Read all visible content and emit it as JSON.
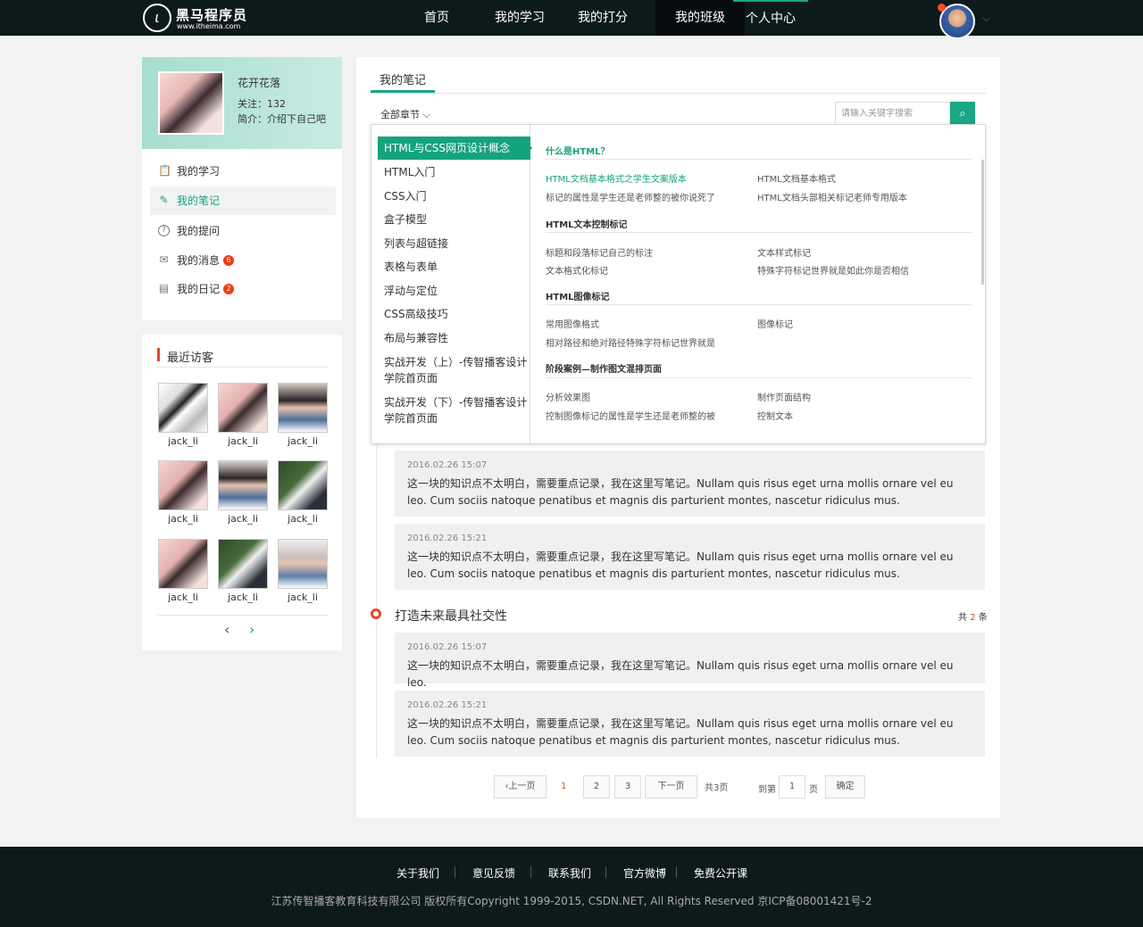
{
  "header": {
    "logo_title": "黑马程序员",
    "logo_sub": "www.itheima.com",
    "logo_mark": "ι",
    "nav": [
      "首页",
      "我的学习",
      "我的打分",
      "我的班级",
      "个人中心"
    ],
    "chevron": "⌵"
  },
  "profile": {
    "name": "花开花落",
    "follows": "关注：132",
    "intro": "简介：介绍下自己吧"
  },
  "menu": [
    {
      "label": "我的学习",
      "icon": "📋"
    },
    {
      "label": "我的笔记",
      "icon": "✎"
    },
    {
      "label": "我的提问",
      "icon": "?"
    },
    {
      "label": "我的消息",
      "icon": "✉",
      "badge": "6"
    },
    {
      "label": "我的日记",
      "icon": "▤",
      "badge": "2"
    }
  ],
  "visitors": {
    "title": "最近访客",
    "names": [
      "jack_li",
      "jack_li",
      "jack_li",
      "jack_li",
      "jack_li",
      "jack_li",
      "jack_li",
      "jack_li",
      "jack_li"
    ],
    "prev": "‹",
    "next": "›"
  },
  "main": {
    "title": "我的笔记",
    "chapter_select": "全部章节 ⌵",
    "search_placeholder": "请输入关键字搜索",
    "search_icon": "⌕"
  },
  "chapters": [
    "HTML与CSS网页设计概念",
    "HTML入门",
    "CSS入门",
    "盒子模型",
    "列表与超链接",
    "表格与表单",
    "浮动与定位",
    "CSS高级技巧",
    "布局与兼容性",
    "实战开发（上）-传智播客设计",
    "学院首页面",
    "实战开发（下）-传智播客设计",
    "学院首页面"
  ],
  "sections": [
    {
      "title": "什么是HTML？",
      "links": [
        "HTML文档基本格式之学生文案版本",
        "HTML文档基本格式",
        "标记的属性是学生还是老师整的被你说死了",
        "HTML文档头部相关标记老师专用版本"
      ]
    },
    {
      "title": "HTML文本控制标记",
      "links": [
        "标题和段落标记自己的标注",
        "文本样式标记",
        "文本格式化标记",
        "特殊字符标记世界就是如此你是否相信"
      ]
    },
    {
      "title": "HTML图像标记",
      "links": [
        "常用图像格式",
        "图像标记",
        "相对路径和绝对路径特殊字符标记世界就是"
      ]
    },
    {
      "title": "阶段案例—制作图文混排页面",
      "links": [
        "分析效果图",
        "制作页面结构",
        "控制图像标记的属性是学生还是老师整的被",
        "控制文本"
      ]
    }
  ],
  "notes_a": [
    {
      "time": "2016.02.26 15:07",
      "body": "这一块的知识点不太明白，需要重点记录，我在这里写笔记。Nullam quis risus eget urna mollis ornare vel eu leo. Cum sociis natoque penatibus et magnis dis parturient montes, nascetur ridiculus mus."
    },
    {
      "time": "2016.02.26 15:21",
      "body": "这一块的知识点不太明白，需要重点记录，我在这里写笔记。Nullam quis risus eget urna mollis ornare vel eu leo. Cum sociis natoque penatibus et magnis dis parturient montes, nascetur ridiculus mus."
    }
  ],
  "section_b": {
    "title": "打造未来最具社交性",
    "count_prefix": "共",
    "count": "2",
    "count_suffix": "条"
  },
  "notes_b": [
    {
      "time": "2016.02.26 15:07",
      "body": "这一块的知识点不太明白，需要重点记录，我在这里写笔记。Nullam quis risus eget urna mollis ornare vel eu leo."
    },
    {
      "time": "2016.02.26 15:21",
      "body": "这一块的知识点不太明白，需要重点记录，我在这里写笔记。Nullam quis risus eget urna mollis ornare vel eu leo. Cum sociis natoque penatibus et magnis dis parturient montes, nascetur ridiculus mus."
    }
  ],
  "pager": {
    "prev": "‹上一页",
    "pages": [
      "1",
      "2",
      "3"
    ],
    "next": "下一页",
    "total": "共3页",
    "goto": "到第",
    "goto_value": "1",
    "page_unit": "页",
    "confirm": "确定"
  },
  "footer": {
    "links": [
      "关于我们",
      "意见反馈",
      "联系我们",
      "官方微博",
      "免费公开课"
    ],
    "copyright": "江苏传智播客教育科技有限公司      版权所有Copyright 1999-2015, CSDN.NET, All Rights Reserved 京ICP备08001421号-2"
  }
}
